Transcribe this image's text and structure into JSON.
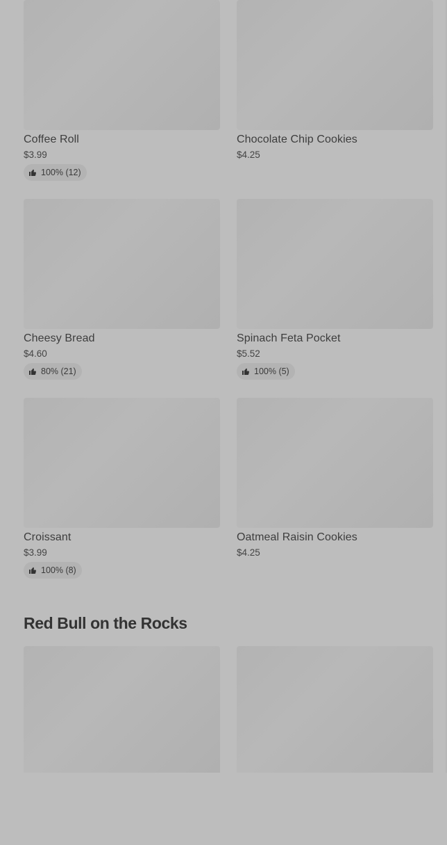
{
  "items": [
    {
      "name": "Coffee Roll",
      "price": "$3.99",
      "rating": "100% (12)"
    },
    {
      "name": "Chocolate Chip Cookies",
      "price": "$4.25",
      "rating": null
    },
    {
      "name": "Cheesy Bread",
      "price": "$4.60",
      "rating": "80% (21)"
    },
    {
      "name": "Spinach Feta Pocket",
      "price": "$5.52",
      "rating": "100% (5)"
    },
    {
      "name": "Croissant",
      "price": "$3.99",
      "rating": "100% (8)"
    },
    {
      "name": "Oatmeal Raisin Cookies",
      "price": "$4.25",
      "rating": null
    }
  ],
  "section": {
    "title": "Red Bull on the Rocks"
  },
  "colors": {
    "background": "#bdbdbd",
    "image_placeholder": "#b3b3b3",
    "text": "#3a3a3a"
  },
  "icons": {
    "rating": "thumbs-up-icon"
  }
}
